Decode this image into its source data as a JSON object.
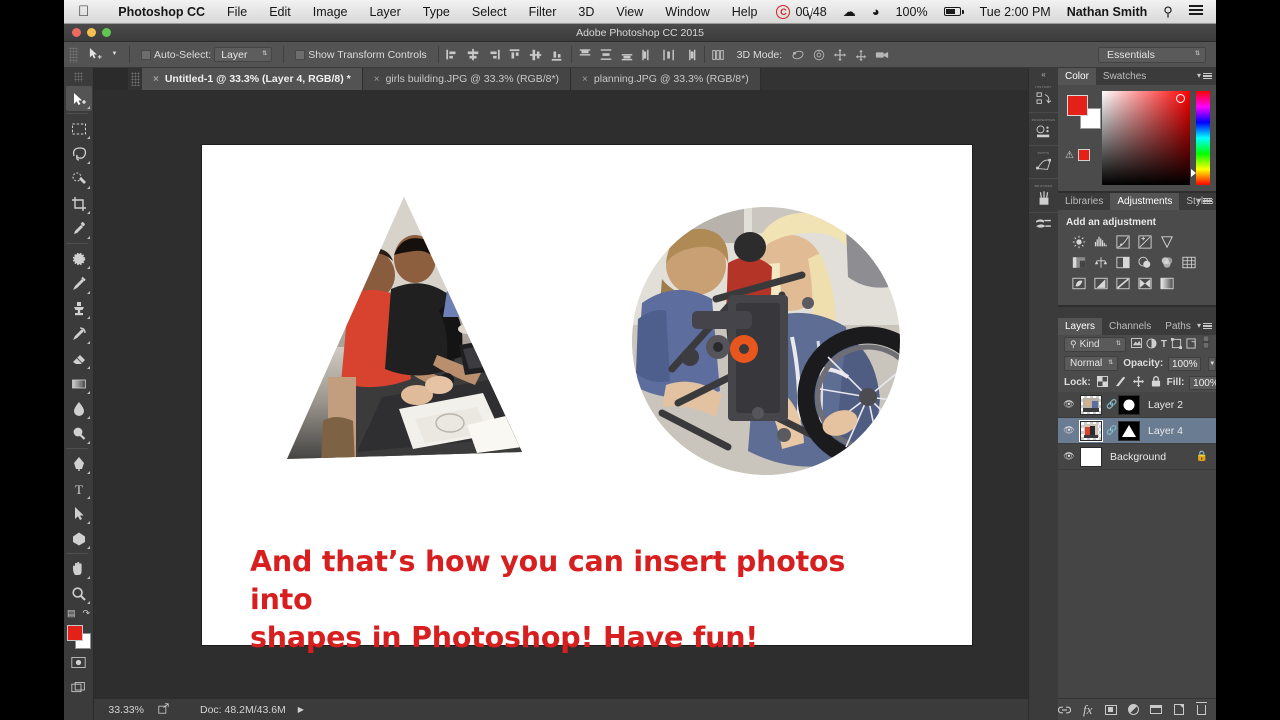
{
  "app": {
    "window_title": "Adobe Photoshop CC 2015",
    "menubar": {
      "apple": "apple-logo",
      "app_name": "Photoshop CC",
      "items": [
        "File",
        "Edit",
        "Image",
        "Layer",
        "Type",
        "Select",
        "Filter",
        "3D",
        "View",
        "Window",
        "Help"
      ],
      "status": {
        "cc_badge": "CC",
        "timer": "00:48",
        "cloud_icon": "creative-cloud-icon",
        "wifi_icon": "wifi-icon",
        "battery_pct": "100%",
        "battery_icon": "battery-charging-icon",
        "clock": "Tue 2:00 PM",
        "user": "Nathan Smith",
        "search_icon": "spotlight-search-icon",
        "notifications_icon": "notification-center-icon"
      }
    }
  },
  "options_bar": {
    "tool_icon": "move-tool-icon",
    "auto_select_label": "Auto-Select:",
    "auto_select_value": "Layer",
    "auto_select_checked": false,
    "show_transform_label": "Show Transform Controls",
    "show_transform_checked": false,
    "align_icons": [
      "align-left-edges-icon",
      "align-horizontal-centers-icon",
      "align-right-edges-icon",
      "align-top-edges-icon",
      "align-vertical-centers-icon",
      "align-bottom-edges-icon"
    ],
    "distribute_icons": [
      "distribute-top-edges-icon",
      "distribute-vertical-centers-icon",
      "distribute-bottom-edges-icon",
      "distribute-left-edges-icon",
      "distribute-horizontal-centers-icon",
      "distribute-right-edges-icon"
    ],
    "extra_icon": "auto-align-layers-icon",
    "mode_3d_label": "3D Mode:",
    "mode_3d_icons": [
      "orbit-3d-icon",
      "roll-3d-icon",
      "pan-3d-icon",
      "slide-3d-icon",
      "zoom-3d-camera-icon"
    ],
    "workspace": "Essentials"
  },
  "document_tabs": [
    {
      "title": "Untitled-1 @ 33.3% (Layer 4, RGB/8) *",
      "active": true
    },
    {
      "title": "girls building.JPG @ 33.3% (RGB/8*)",
      "active": false
    },
    {
      "title": "planning.JPG @ 33.3% (RGB/8*)",
      "active": false
    }
  ],
  "tools": [
    {
      "name": "move-tool",
      "glyph": "move",
      "selected": true
    },
    {
      "name": "rectangular-marquee-tool",
      "glyph": "marquee",
      "selected": false
    },
    {
      "name": "lasso-tool",
      "glyph": "lasso",
      "selected": false
    },
    {
      "name": "quick-selection-tool",
      "glyph": "quick-select",
      "selected": false
    },
    {
      "name": "crop-tool",
      "glyph": "crop",
      "selected": false
    },
    {
      "name": "eyedropper-tool",
      "glyph": "eyedropper",
      "selected": false
    },
    {
      "name": "spot-healing-brush-tool",
      "glyph": "healing",
      "selected": false
    },
    {
      "name": "brush-tool",
      "glyph": "brush",
      "selected": false
    },
    {
      "name": "clone-stamp-tool",
      "glyph": "stamp",
      "selected": false
    },
    {
      "name": "history-brush-tool",
      "glyph": "history-brush",
      "selected": false
    },
    {
      "name": "eraser-tool",
      "glyph": "eraser",
      "selected": false
    },
    {
      "name": "gradient-tool",
      "glyph": "gradient",
      "selected": false
    },
    {
      "name": "blur-tool",
      "glyph": "blur",
      "selected": false
    },
    {
      "name": "dodge-tool",
      "glyph": "dodge",
      "selected": false
    },
    {
      "name": "pen-tool",
      "glyph": "pen",
      "selected": false
    },
    {
      "name": "type-tool",
      "glyph": "type",
      "selected": false
    },
    {
      "name": "path-selection-tool",
      "glyph": "path-select",
      "selected": false
    },
    {
      "name": "polygon-shape-tool",
      "glyph": "polygon",
      "selected": false
    },
    {
      "name": "hand-tool",
      "glyph": "hand",
      "selected": false
    },
    {
      "name": "zoom-tool",
      "glyph": "zoom",
      "selected": false
    }
  ],
  "tool_footer": {
    "default_colors_icon": "default-colors-icon",
    "swap_colors_icon": "swap-colors-icon",
    "foreground_color": "#e32119",
    "background_color": "#ffffff",
    "quick_mask_icon": "quick-mask-mode-icon",
    "screen_mode_icon": "screen-mode-icon"
  },
  "canvas": {
    "caption_line1": "And that’s how you can insert photos into",
    "caption_line2": "shapes in Photoshop!  Have fun!",
    "caption_color": "#d81f1f",
    "shape_left": "triangle-masked-photo-planning",
    "shape_right": "circle-masked-photo-girls-building"
  },
  "status_bar": {
    "zoom": "33.33%",
    "share_icon": "share-icon",
    "doc_info": "Doc: 48.2M/43.6M",
    "expand_icon": "expand-arrow-icon"
  },
  "icon_rail": [
    {
      "caption": "HISTORY",
      "icon": "history-panel-icon"
    },
    {
      "caption": "PROPERTIES",
      "icon": "properties-panel-icon"
    },
    {
      "caption": "PATHS",
      "icon": "paths-panel-icon"
    },
    {
      "caption": "BRUSHES",
      "icon": "brush-panel-icon"
    },
    {
      "caption": "",
      "icon": "brush-presets-panel-icon"
    }
  ],
  "panels": {
    "color": {
      "tabs": [
        {
          "label": "Color",
          "active": true
        },
        {
          "label": "Swatches",
          "active": false
        }
      ],
      "menu_icon": "panel-menu-icon",
      "foreground": "#e32119",
      "background": "#ffffff",
      "out_of_gamut_icon": "out-of-gamut-warning-icon",
      "out_of_gamut_swatch": "#e32119"
    },
    "adjustments": {
      "tabs": [
        {
          "label": "Libraries",
          "active": false
        },
        {
          "label": "Adjustments",
          "active": true
        },
        {
          "label": "Styles",
          "active": false
        }
      ],
      "menu_icon": "panel-menu-icon",
      "heading": "Add an adjustment",
      "row1": [
        "brightness-contrast-icon",
        "levels-icon",
        "curves-icon",
        "exposure-icon",
        "vibrance-icon"
      ],
      "row2": [
        "hue-saturation-icon",
        "color-balance-icon",
        "black-white-icon",
        "photo-filter-icon",
        "channel-mixer-icon",
        "color-lookup-icon"
      ],
      "row3": [
        "invert-icon",
        "posterize-icon",
        "threshold-icon",
        "selective-color-icon",
        "gradient-map-icon"
      ]
    },
    "layers": {
      "tabs": [
        {
          "label": "Layers",
          "active": true
        },
        {
          "label": "Channels",
          "active": false
        },
        {
          "label": "Paths",
          "active": false
        }
      ],
      "menu_icon": "panel-menu-icon",
      "filter_kind": "Kind",
      "filter_icons": [
        "filter-pixel-icon",
        "filter-adjustment-icon",
        "filter-type-icon",
        "filter-shape-icon",
        "filter-smart-object-icon"
      ],
      "filter_toggle_icon": "filter-enable-toggle",
      "blend_mode": "Normal",
      "opacity_label": "Opacity:",
      "opacity_value": "100%",
      "lock_label": "Lock:",
      "lock_icons": [
        "lock-transparent-pixels-icon",
        "lock-image-pixels-icon",
        "lock-position-icon",
        "lock-all-icon"
      ],
      "fill_label": "Fill:",
      "fill_value": "100%",
      "rows": [
        {
          "name": "Layer 2",
          "visible": true,
          "selected": false,
          "mask": "circle",
          "linked": true,
          "locked": false
        },
        {
          "name": "Layer 4",
          "visible": true,
          "selected": true,
          "mask": "triangle",
          "linked": true,
          "locked": false
        },
        {
          "name": "Background",
          "visible": true,
          "selected": false,
          "mask": "none",
          "linked": false,
          "locked": true
        }
      ],
      "footer_icons": [
        "link-layers-icon",
        "layer-style-fx-icon",
        "add-layer-mask-icon",
        "new-fill-adjustment-icon",
        "new-group-icon",
        "new-layer-icon",
        "delete-layer-icon"
      ],
      "fx_label": "fx"
    }
  }
}
